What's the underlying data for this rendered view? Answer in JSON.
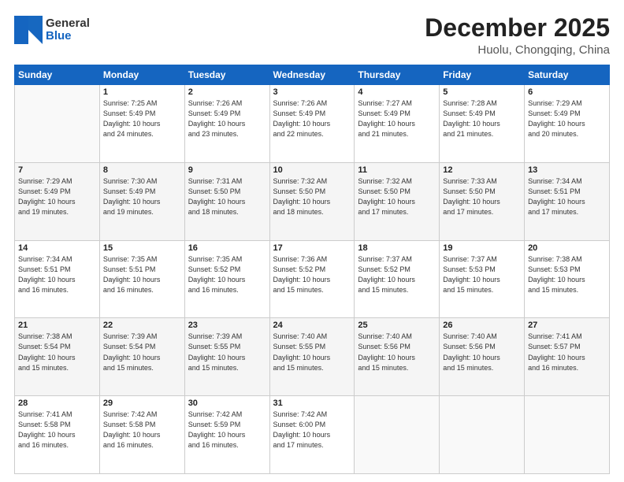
{
  "header": {
    "logo_general": "General",
    "logo_blue": "Blue",
    "month": "December 2025",
    "location": "Huolu, Chongqing, China"
  },
  "days_of_week": [
    "Sunday",
    "Monday",
    "Tuesday",
    "Wednesday",
    "Thursday",
    "Friday",
    "Saturday"
  ],
  "weeks": [
    [
      {
        "day": "",
        "info": ""
      },
      {
        "day": "1",
        "info": "Sunrise: 7:25 AM\nSunset: 5:49 PM\nDaylight: 10 hours\nand 24 minutes."
      },
      {
        "day": "2",
        "info": "Sunrise: 7:26 AM\nSunset: 5:49 PM\nDaylight: 10 hours\nand 23 minutes."
      },
      {
        "day": "3",
        "info": "Sunrise: 7:26 AM\nSunset: 5:49 PM\nDaylight: 10 hours\nand 22 minutes."
      },
      {
        "day": "4",
        "info": "Sunrise: 7:27 AM\nSunset: 5:49 PM\nDaylight: 10 hours\nand 21 minutes."
      },
      {
        "day": "5",
        "info": "Sunrise: 7:28 AM\nSunset: 5:49 PM\nDaylight: 10 hours\nand 21 minutes."
      },
      {
        "day": "6",
        "info": "Sunrise: 7:29 AM\nSunset: 5:49 PM\nDaylight: 10 hours\nand 20 minutes."
      }
    ],
    [
      {
        "day": "7",
        "info": "Sunrise: 7:29 AM\nSunset: 5:49 PM\nDaylight: 10 hours\nand 19 minutes."
      },
      {
        "day": "8",
        "info": "Sunrise: 7:30 AM\nSunset: 5:49 PM\nDaylight: 10 hours\nand 19 minutes."
      },
      {
        "day": "9",
        "info": "Sunrise: 7:31 AM\nSunset: 5:50 PM\nDaylight: 10 hours\nand 18 minutes."
      },
      {
        "day": "10",
        "info": "Sunrise: 7:32 AM\nSunset: 5:50 PM\nDaylight: 10 hours\nand 18 minutes."
      },
      {
        "day": "11",
        "info": "Sunrise: 7:32 AM\nSunset: 5:50 PM\nDaylight: 10 hours\nand 17 minutes."
      },
      {
        "day": "12",
        "info": "Sunrise: 7:33 AM\nSunset: 5:50 PM\nDaylight: 10 hours\nand 17 minutes."
      },
      {
        "day": "13",
        "info": "Sunrise: 7:34 AM\nSunset: 5:51 PM\nDaylight: 10 hours\nand 17 minutes."
      }
    ],
    [
      {
        "day": "14",
        "info": "Sunrise: 7:34 AM\nSunset: 5:51 PM\nDaylight: 10 hours\nand 16 minutes."
      },
      {
        "day": "15",
        "info": "Sunrise: 7:35 AM\nSunset: 5:51 PM\nDaylight: 10 hours\nand 16 minutes."
      },
      {
        "day": "16",
        "info": "Sunrise: 7:35 AM\nSunset: 5:52 PM\nDaylight: 10 hours\nand 16 minutes."
      },
      {
        "day": "17",
        "info": "Sunrise: 7:36 AM\nSunset: 5:52 PM\nDaylight: 10 hours\nand 15 minutes."
      },
      {
        "day": "18",
        "info": "Sunrise: 7:37 AM\nSunset: 5:52 PM\nDaylight: 10 hours\nand 15 minutes."
      },
      {
        "day": "19",
        "info": "Sunrise: 7:37 AM\nSunset: 5:53 PM\nDaylight: 10 hours\nand 15 minutes."
      },
      {
        "day": "20",
        "info": "Sunrise: 7:38 AM\nSunset: 5:53 PM\nDaylight: 10 hours\nand 15 minutes."
      }
    ],
    [
      {
        "day": "21",
        "info": "Sunrise: 7:38 AM\nSunset: 5:54 PM\nDaylight: 10 hours\nand 15 minutes."
      },
      {
        "day": "22",
        "info": "Sunrise: 7:39 AM\nSunset: 5:54 PM\nDaylight: 10 hours\nand 15 minutes."
      },
      {
        "day": "23",
        "info": "Sunrise: 7:39 AM\nSunset: 5:55 PM\nDaylight: 10 hours\nand 15 minutes."
      },
      {
        "day": "24",
        "info": "Sunrise: 7:40 AM\nSunset: 5:55 PM\nDaylight: 10 hours\nand 15 minutes."
      },
      {
        "day": "25",
        "info": "Sunrise: 7:40 AM\nSunset: 5:56 PM\nDaylight: 10 hours\nand 15 minutes."
      },
      {
        "day": "26",
        "info": "Sunrise: 7:40 AM\nSunset: 5:56 PM\nDaylight: 10 hours\nand 15 minutes."
      },
      {
        "day": "27",
        "info": "Sunrise: 7:41 AM\nSunset: 5:57 PM\nDaylight: 10 hours\nand 16 minutes."
      }
    ],
    [
      {
        "day": "28",
        "info": "Sunrise: 7:41 AM\nSunset: 5:58 PM\nDaylight: 10 hours\nand 16 minutes."
      },
      {
        "day": "29",
        "info": "Sunrise: 7:42 AM\nSunset: 5:58 PM\nDaylight: 10 hours\nand 16 minutes."
      },
      {
        "day": "30",
        "info": "Sunrise: 7:42 AM\nSunset: 5:59 PM\nDaylight: 10 hours\nand 16 minutes."
      },
      {
        "day": "31",
        "info": "Sunrise: 7:42 AM\nSunset: 6:00 PM\nDaylight: 10 hours\nand 17 minutes."
      },
      {
        "day": "",
        "info": ""
      },
      {
        "day": "",
        "info": ""
      },
      {
        "day": "",
        "info": ""
      }
    ]
  ]
}
